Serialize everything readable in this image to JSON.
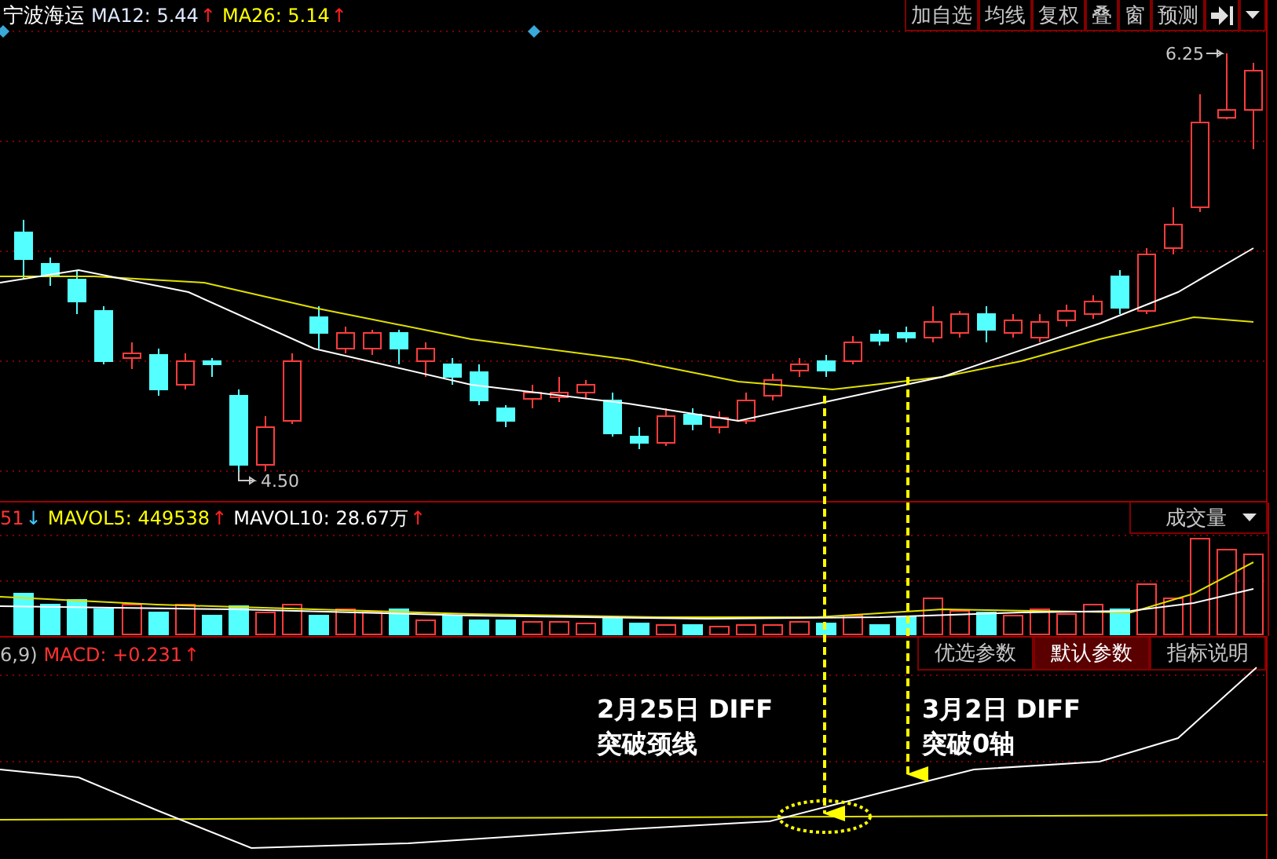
{
  "header": {
    "title": "宁波海运",
    "indicators": [
      {
        "kind": "ma12",
        "value": "MA12: 5.44",
        "arrow": "↑"
      },
      {
        "kind": "ma26",
        "value": "MA26: 5.14",
        "arrow": "↑"
      }
    ]
  },
  "toolbar": {
    "buttons": [
      "加自选",
      "均线",
      "复权",
      "叠",
      "窗",
      "预测"
    ]
  },
  "price_chart": {
    "high_label": "6.25",
    "low_label": "4.50"
  },
  "volume": {
    "indicators": [
      {
        "kind": "vol",
        "value": "51",
        "arrow": "↓"
      },
      {
        "kind": "mavol5",
        "value": "MAVOL5: 449538",
        "arrow": "↑"
      },
      {
        "kind": "mavol10",
        "value": "MAVOL10: 28.67万",
        "arrow": "↑"
      }
    ],
    "selector": {
      "label": "成交量"
    }
  },
  "indicator_tabs": [
    {
      "label": "优选参数",
      "selected": false
    },
    {
      "label": "默认参数",
      "selected": true
    },
    {
      "label": "指标说明",
      "selected": false
    }
  ],
  "macd": {
    "indicators": [
      {
        "kind": "params",
        "value": "6,9)"
      },
      {
        "kind": "macd",
        "value": "MACD: +0.231",
        "arrow": "↑"
      }
    ]
  },
  "annotations": [
    {
      "line_1": "2月25日 DIFF",
      "line_2": "突破颈线"
    },
    {
      "line_1": "3月2日 DIFF",
      "line_2": "突破0轴"
    }
  ]
}
